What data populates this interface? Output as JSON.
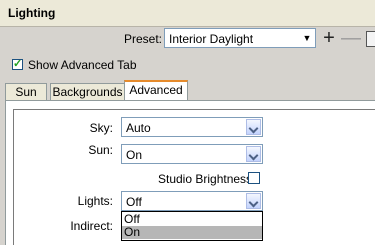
{
  "window": {
    "title": "Lighting"
  },
  "preset": {
    "label": "Preset:",
    "value": "Interior Daylight"
  },
  "toolbar": {
    "add": "+",
    "remove": "—"
  },
  "show_advanced": {
    "label": "Show Advanced Tab",
    "checked": true
  },
  "tabs": [
    {
      "label": "Sun",
      "active": false
    },
    {
      "label": "Backgrounds",
      "active": false
    },
    {
      "label": "Advanced",
      "active": true
    }
  ],
  "fields": {
    "sky": {
      "label": "Sky:",
      "value": "Auto"
    },
    "sun": {
      "label": "Sun:",
      "value": "On"
    },
    "studio_brightness": {
      "label": "Studio Brightness",
      "checked": false
    },
    "lights": {
      "label": "Lights:",
      "value": "Off"
    },
    "indirect": {
      "label": "Indirect:"
    }
  },
  "lights_dropdown": {
    "options": [
      {
        "label": "Off",
        "highlighted": false
      },
      {
        "label": "On",
        "highlighted": true
      }
    ]
  }
}
